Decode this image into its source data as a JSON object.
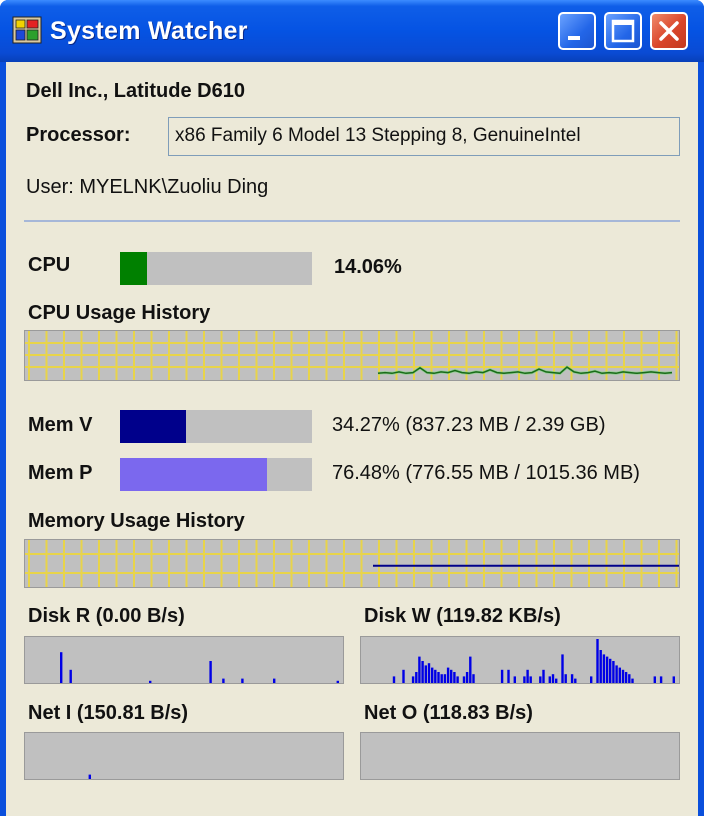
{
  "window": {
    "title": "System Watcher",
    "icon": "app-icon",
    "buttons": {
      "minimize": "minimize-icon",
      "maximize": "maximize-icon",
      "close": "close-icon"
    }
  },
  "system": {
    "model": "Dell Inc., Latitude D610",
    "processor_label": "Processor:",
    "processor_value": "x86 Family 6 Model 13 Stepping 8, GenuineIntel",
    "user": "User: MYELNK\\Zuoliu Ding"
  },
  "cpu": {
    "label": "CPU",
    "value_text": "14.06%",
    "fraction": 0.1406,
    "color": "#008000",
    "history_title": "CPU Usage History",
    "history": [
      0.04,
      0.05,
      0.04,
      0.06,
      0.04,
      0.05,
      0.12,
      0.05,
      0.04,
      0.06,
      0.05,
      0.08,
      0.05,
      0.04,
      0.06,
      0.05,
      0.09,
      0.05,
      0.04,
      0.05,
      0.06,
      0.04,
      0.05,
      0.1,
      0.06,
      0.05,
      0.04,
      0.13,
      0.06,
      0.04,
      0.05,
      0.07,
      0.04,
      0.05,
      0.04,
      0.06,
      0.05,
      0.04,
      0.05,
      0.06,
      0.05,
      0.04,
      0.05
    ]
  },
  "memory": {
    "virtual": {
      "label": "Mem V",
      "value_text": "34.27% (837.23 MB / 2.39 GB)",
      "fraction": 0.3427,
      "color": "#00008b"
    },
    "physical": {
      "label": "Mem P",
      "value_text": "76.48% (776.55 MB / 1015.36 MB)",
      "fraction": 0.7648,
      "color": "#7b68ee"
    },
    "history_title": "Memory Usage History"
  },
  "disk": {
    "read": {
      "label": "Disk R (0.00 B/s)",
      "history": [
        0,
        0,
        0,
        0,
        0,
        0,
        0,
        0,
        0,
        0,
        0,
        0.7,
        0,
        0,
        0.3,
        0,
        0,
        0,
        0,
        0,
        0,
        0,
        0,
        0,
        0,
        0,
        0,
        0,
        0,
        0,
        0,
        0,
        0,
        0,
        0,
        0,
        0,
        0,
        0,
        0.05,
        0,
        0,
        0,
        0,
        0,
        0,
        0,
        0,
        0,
        0,
        0,
        0,
        0,
        0,
        0,
        0,
        0,
        0,
        0.5,
        0,
        0,
        0,
        0.1,
        0,
        0,
        0,
        0,
        0,
        0.1,
        0,
        0,
        0,
        0,
        0,
        0,
        0,
        0,
        0,
        0.1,
        0,
        0,
        0,
        0,
        0,
        0,
        0,
        0,
        0,
        0,
        0,
        0,
        0,
        0,
        0,
        0,
        0,
        0,
        0,
        0.05,
        0
      ]
    },
    "write": {
      "label": "Disk W (119.82 KB/s)",
      "history": [
        0,
        0,
        0,
        0,
        0,
        0,
        0,
        0,
        0,
        0,
        0.15,
        0,
        0,
        0.3,
        0,
        0,
        0.15,
        0.25,
        0.6,
        0.5,
        0.4,
        0.45,
        0.35,
        0.3,
        0.25,
        0.2,
        0.2,
        0.35,
        0.3,
        0.25,
        0.15,
        0,
        0.15,
        0.25,
        0.6,
        0.2,
        0,
        0,
        0,
        0,
        0,
        0,
        0,
        0,
        0.3,
        0,
        0.3,
        0,
        0.15,
        0,
        0,
        0.15,
        0.3,
        0.15,
        0,
        0,
        0.15,
        0.3,
        0,
        0.15,
        0.2,
        0.1,
        0,
        0.65,
        0.2,
        0,
        0.2,
        0.1,
        0,
        0,
        0,
        0,
        0.15,
        0,
        1,
        0.75,
        0.65,
        0.6,
        0.55,
        0.5,
        0.4,
        0.35,
        0.3,
        0.25,
        0.2,
        0.1,
        0,
        0,
        0,
        0,
        0,
        0,
        0.15,
        0,
        0.15,
        0,
        0,
        0,
        0.15,
        0
      ]
    }
  },
  "network": {
    "in": {
      "label": "Net I (150.81 B/s)",
      "history": [
        0,
        0,
        0,
        0,
        0,
        0,
        0,
        0,
        0,
        0,
        0,
        0,
        0,
        0,
        0,
        0,
        0,
        0,
        0,
        0,
        0.1,
        0,
        0,
        0,
        0,
        0,
        0,
        0,
        0,
        0,
        0,
        0,
        0,
        0,
        0,
        0,
        0,
        0,
        0,
        0,
        0,
        0,
        0,
        0,
        0,
        0,
        0,
        0,
        0,
        0,
        0,
        0,
        0,
        0,
        0,
        0,
        0,
        0,
        0,
        0,
        0,
        0,
        0,
        0,
        0,
        0,
        0,
        0,
        0,
        0,
        0,
        0,
        0,
        0,
        0,
        0,
        0,
        0,
        0,
        0,
        0,
        0,
        0,
        0,
        0,
        0,
        0,
        0,
        0,
        0,
        0,
        0,
        0,
        0,
        0,
        0,
        0,
        0,
        0,
        0
      ]
    },
    "out": {
      "label": "Net O (118.83 B/s)",
      "history": [
        0,
        0,
        0,
        0,
        0,
        0,
        0,
        0,
        0,
        0,
        0,
        0,
        0,
        0,
        0,
        0,
        0,
        0,
        0,
        0,
        0,
        0,
        0,
        0,
        0,
        0,
        0,
        0,
        0,
        0,
        0,
        0,
        0,
        0,
        0,
        0,
        0,
        0,
        0,
        0,
        0,
        0,
        0,
        0,
        0,
        0,
        0,
        0,
        0,
        0,
        0,
        0,
        0,
        0,
        0,
        0,
        0,
        0,
        0,
        0,
        0,
        0,
        0,
        0,
        0,
        0,
        0,
        0,
        0,
        0,
        0,
        0,
        0,
        0,
        0,
        0,
        0,
        0,
        0,
        0,
        0,
        0,
        0,
        0,
        0,
        0,
        0,
        0,
        0,
        0,
        0,
        0,
        0,
        0,
        0,
        0,
        0,
        0,
        0,
        0
      ]
    }
  },
  "colors": {
    "graph_bg": "#c0c0c0",
    "grid": "#e8d44a",
    "cpu_line": "#1a6a1a",
    "mem_line": "#00008b",
    "activity": "#0000e6"
  }
}
